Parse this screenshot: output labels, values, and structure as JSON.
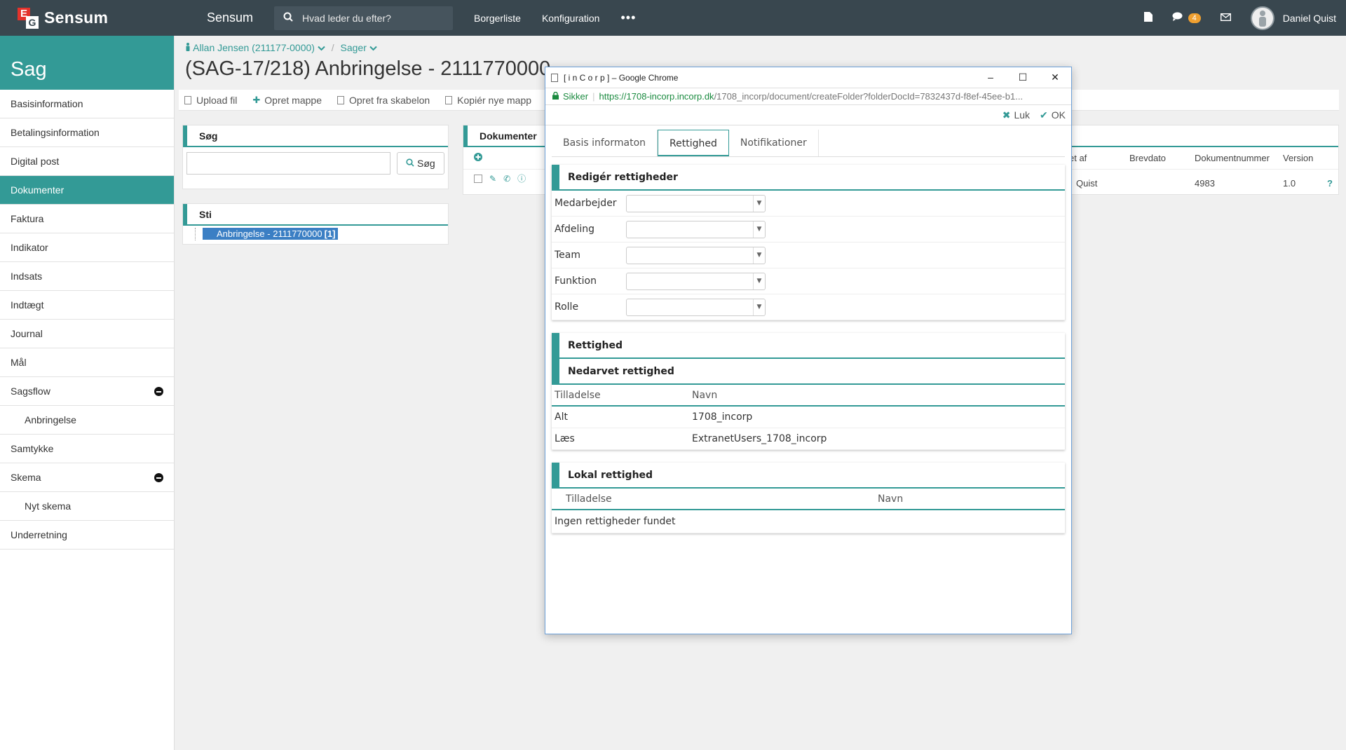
{
  "topbar": {
    "logo_e": "E",
    "logo_g": "G",
    "logo_text": "Sensum",
    "app_name": "Sensum",
    "search_placeholder": "Hvad leder du efter?",
    "nav": [
      "Borgerliste",
      "Konfiguration"
    ],
    "more": "•••",
    "chat_count": "4",
    "user_name": "Daniel Quist"
  },
  "sidebar": {
    "title": "Sag",
    "items": [
      {
        "label": "Basisinformation"
      },
      {
        "label": "Betalingsinformation"
      },
      {
        "label": "Digital post"
      },
      {
        "label": "Dokumenter"
      },
      {
        "label": "Faktura"
      },
      {
        "label": "Indikator"
      },
      {
        "label": "Indsats"
      },
      {
        "label": "Indtægt"
      },
      {
        "label": "Journal"
      },
      {
        "label": "Mål"
      },
      {
        "label": "Sagsflow"
      },
      {
        "label": "Anbringelse"
      },
      {
        "label": "Samtykke"
      },
      {
        "label": "Skema"
      },
      {
        "label": "Nyt skema"
      },
      {
        "label": "Underretning"
      }
    ]
  },
  "breadcrumb": {
    "person": "Allan Jensen (211177-0000)",
    "cases": "Sager",
    "separator": "/"
  },
  "page_title": "(SAG-17/218) Anbringelse - 2111770000",
  "toolbar": {
    "upload": "Upload fil",
    "create_folder": "Opret mappe",
    "from_template": "Opret fra skabelon",
    "copy": "Kopiér nye mapp"
  },
  "search_panel": {
    "title": "Søg",
    "button": "Søg"
  },
  "path_panel": {
    "title": "Sti",
    "selected": "Anbringelse - 2111770000",
    "count": "[1]"
  },
  "documents_panel": {
    "title": "Dokumenter",
    "columns": [
      "et af",
      "Brevdato",
      "Dokumentnummer",
      "Version"
    ],
    "row": {
      "created_by": "Quist",
      "doc_number": "4983",
      "version": "1.0",
      "help": "?"
    }
  },
  "popup": {
    "window_title": "[ i n C o r p ] – Google Chrome",
    "url_secure": "Sikker",
    "url_host": "https://1708-incorp.incorp.dk",
    "url_path": "/1708_incorp/document/createFolder?folderDocId=7832437d-f8ef-45ee-b1...",
    "close_label": "Luk",
    "ok_label": "OK",
    "tabs": [
      "Basis informaton",
      "Rettighed",
      "Notifikationer"
    ],
    "edit_section": {
      "title": "Redigér rettigheder",
      "fields": [
        "Medarbejder",
        "Afdeling",
        "Team",
        "Funktion",
        "Rolle"
      ]
    },
    "rights_title": "Rettighed",
    "inherited": {
      "title": "Nedarvet rettighed",
      "columns": [
        "Tilladelse",
        "Navn"
      ],
      "rows": [
        {
          "permission": "Alt",
          "name": "1708_incorp"
        },
        {
          "permission": "Læs",
          "name": "ExtranetUsers_1708_incorp"
        }
      ]
    },
    "local": {
      "title": "Lokal rettighed",
      "columns": [
        "Tilladelse",
        "Navn"
      ],
      "empty": "Ingen rettigheder fundet"
    }
  }
}
